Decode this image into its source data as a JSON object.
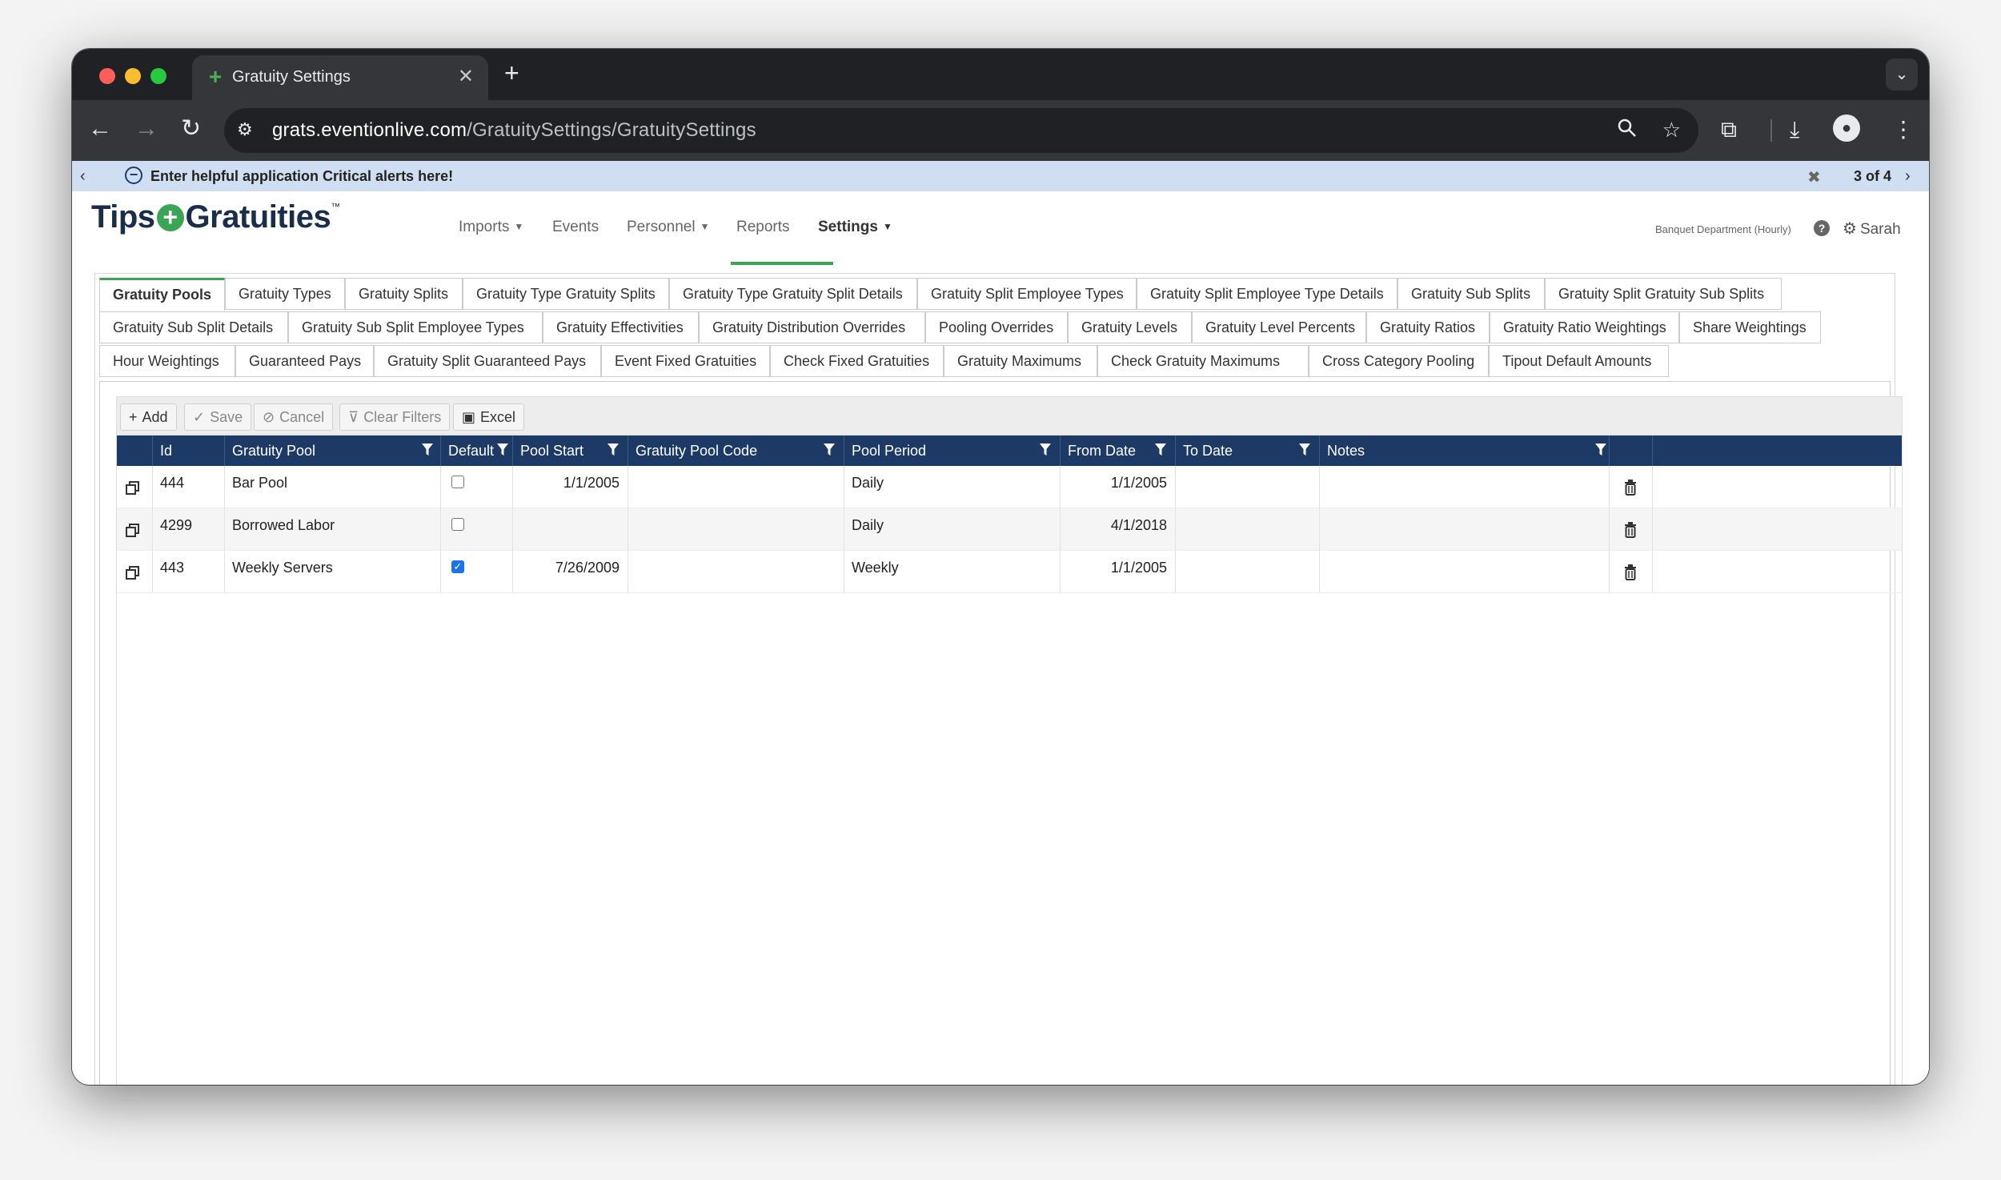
{
  "browser": {
    "tab_title": "Gratuity Settings",
    "url_host": "grats.eventionlive.com",
    "url_path": "/GratuitySettings/GratuitySettings"
  },
  "alert": {
    "text": "Enter helpful application Critical alerts here!",
    "counter": "3 of 4"
  },
  "header": {
    "logo_left": "Tips",
    "logo_right": "Gratuities",
    "logo_tm": "™",
    "nav": [
      {
        "label": "Imports",
        "has_caret": true
      },
      {
        "label": "Events",
        "has_caret": false
      },
      {
        "label": "Personnel",
        "has_caret": true
      },
      {
        "label": "Reports",
        "has_caret": false
      },
      {
        "label": "Settings",
        "has_caret": true,
        "active": true
      }
    ],
    "department": "Banquet Department (Hourly)",
    "user": "Sarah"
  },
  "subtabs": {
    "row1": [
      "Gratuity Pools",
      "Gratuity Types",
      "Gratuity Splits",
      "Gratuity Type Gratuity Splits",
      "Gratuity Type Gratuity Split Details",
      "Gratuity Split Employee Types",
      "Gratuity Split Employee Type Details",
      "Gratuity Sub Splits",
      "Gratuity Split Gratuity Sub Splits"
    ],
    "row2": [
      "Gratuity Sub Split Details",
      "Gratuity Sub Split Employee Types",
      "Gratuity Effectivities",
      "Gratuity Distribution Overrides",
      "Pooling Overrides",
      "Gratuity Levels",
      "Gratuity Level Percents",
      "Gratuity Ratios",
      "Gratuity Ratio Weightings",
      "Share Weightings"
    ],
    "row3": [
      "Hour Weightings",
      "Guaranteed Pays",
      "Gratuity Split Guaranteed Pays",
      "Event Fixed Gratuities",
      "Check Fixed Gratuities",
      "Gratuity Maximums",
      "Check Gratuity Maximums",
      "Cross Category Pooling",
      "Tipout Default Amounts"
    ],
    "active": "Gratuity Pools"
  },
  "toolbar": {
    "add": "Add",
    "save": "Save",
    "cancel": "Cancel",
    "clear_filters": "Clear Filters",
    "excel": "Excel"
  },
  "grid": {
    "columns": [
      "Id",
      "Gratuity Pool",
      "Default",
      "Pool Start",
      "Gratuity Pool Code",
      "Pool Period",
      "From Date",
      "To Date",
      "Notes"
    ],
    "rows": [
      {
        "id": "444",
        "pool": "Bar Pool",
        "default": false,
        "pool_start": "1/1/2005",
        "code": "",
        "period": "Daily",
        "from_date": "1/1/2005",
        "to_date": "",
        "notes": ""
      },
      {
        "id": "4299",
        "pool": "Borrowed Labor",
        "default": false,
        "pool_start": "",
        "code": "",
        "period": "Daily",
        "from_date": "4/1/2018",
        "to_date": "",
        "notes": ""
      },
      {
        "id": "443",
        "pool": "Weekly Servers",
        "default": true,
        "pool_start": "7/26/2009",
        "code": "",
        "period": "Weekly",
        "from_date": "1/1/2005",
        "to_date": "",
        "notes": ""
      }
    ]
  },
  "colors": {
    "header_bg": "#1d3a66",
    "accent": "#3aa655",
    "alert_bg": "#cfdff1"
  }
}
